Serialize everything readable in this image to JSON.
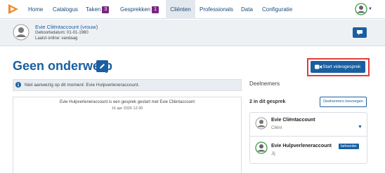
{
  "nav": {
    "items": [
      {
        "label": "Home"
      },
      {
        "label": "Catalogus"
      },
      {
        "label": "Taken",
        "badge": "3"
      },
      {
        "label": "Gesprekken",
        "badge": "1"
      },
      {
        "label": "Cliënten"
      },
      {
        "label": "Professionals"
      },
      {
        "label": "Data"
      },
      {
        "label": "Configuratie"
      }
    ],
    "active": "Cliënten"
  },
  "client": {
    "name": "Evie Cliëntaccount (vrouw)",
    "dob": "Geboortedatum: 01-01-1980",
    "online": "Laatst online: vandaag"
  },
  "conversation": {
    "title": "Geen onderwerp",
    "start_video_label": "Start videogesprek",
    "notice": "Niet aanwezig op dit moment: Evie Hulpverleneraccount.",
    "message": "Evie Hulpverleneraccount is een gesprek gestart met Evie Cliëntaccount",
    "message_time": "16 apr 2026 12:30"
  },
  "participants": {
    "heading": "Deelnemers",
    "count": "2 in dit gesprek",
    "add_label": "Deelnemers toevoegen",
    "list": [
      {
        "name": "Evie Cliëntaccount",
        "role": "Cliënt"
      },
      {
        "name": "Evie Hulpverleneraccount",
        "role": "Jij",
        "badge": "beheerder"
      }
    ]
  },
  "colors": {
    "primary": "#1a5fa0",
    "badge": "#7b2580",
    "highlight": "#e23b3b"
  },
  "icons": [
    "logo-icon",
    "user-avatar-icon",
    "chevron-down-icon",
    "chat-icon",
    "pencil-icon",
    "video-camera-icon",
    "info-icon"
  ]
}
